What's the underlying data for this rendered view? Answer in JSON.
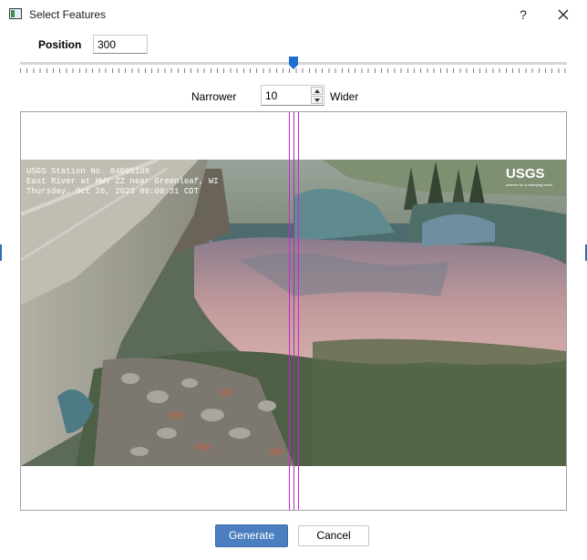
{
  "window": {
    "title": "Select Features",
    "help": "?",
    "close_icon": "close-icon"
  },
  "position": {
    "label": "Position",
    "value": "300"
  },
  "slider": {
    "min": 0,
    "max": 600,
    "value": 300
  },
  "width": {
    "narrow_label": "Narrower",
    "value": "10",
    "wide_label": "Wider"
  },
  "preview": {
    "overlay_lines": [
      "USGS Station No. 04085108",
      "East River at HWY ZZ near Greenleaf, WI",
      "Thursday, Oct 26, 2023  08:00:31 CDT"
    ],
    "logo_text": "USGS",
    "logo_tagline": "science for a changing world",
    "line_colors": {
      "outer": "#d020d0",
      "center": "#a030c0"
    }
  },
  "buttons": {
    "generate": "Generate",
    "cancel": "Cancel"
  },
  "colors": {
    "accent": "#4b7fbf",
    "slider_handle": "#1f6fd0"
  }
}
